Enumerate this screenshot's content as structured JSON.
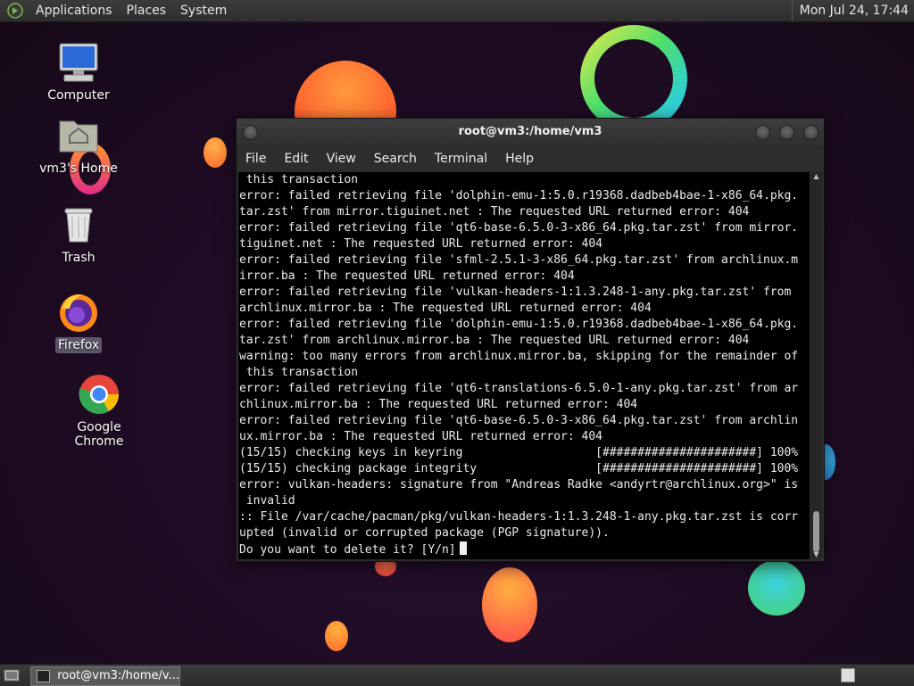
{
  "top_panel": {
    "menus": [
      "Applications",
      "Places",
      "System"
    ],
    "clock": "Mon Jul 24, 17:44"
  },
  "desktop": {
    "icons": [
      {
        "label": "Computer"
      },
      {
        "label": "vm3's Home"
      },
      {
        "label": "Trash"
      },
      {
        "label": "Firefox"
      },
      {
        "label": "Google Chrome"
      }
    ]
  },
  "terminal": {
    "title": "root@vm3:/home/vm3",
    "menu": [
      "File",
      "Edit",
      "View",
      "Search",
      "Terminal",
      "Help"
    ],
    "lines": [
      " this transaction",
      "error: failed retrieving file 'dolphin-emu-1:5.0.r19368.dadbeb4bae-1-x86_64.pkg.",
      "tar.zst' from mirror.tiguinet.net : The requested URL returned error: 404",
      "error: failed retrieving file 'qt6-base-6.5.0-3-x86_64.pkg.tar.zst' from mirror.",
      "tiguinet.net : The requested URL returned error: 404",
      "error: failed retrieving file 'sfml-2.5.1-3-x86_64.pkg.tar.zst' from archlinux.m",
      "irror.ba : The requested URL returned error: 404",
      "error: failed retrieving file 'vulkan-headers-1:1.3.248-1-any.pkg.tar.zst' from",
      "archlinux.mirror.ba : The requested URL returned error: 404",
      "error: failed retrieving file 'dolphin-emu-1:5.0.r19368.dadbeb4bae-1-x86_64.pkg.",
      "tar.zst' from archlinux.mirror.ba : The requested URL returned error: 404",
      "warning: too many errors from archlinux.mirror.ba, skipping for the remainder of",
      " this transaction",
      "error: failed retrieving file 'qt6-translations-6.5.0-1-any.pkg.tar.zst' from ar",
      "chlinux.mirror.ba : The requested URL returned error: 404",
      "error: failed retrieving file 'qt6-base-6.5.0-3-x86_64.pkg.tar.zst' from archlin",
      "ux.mirror.ba : The requested URL returned error: 404",
      "(15/15) checking keys in keyring                   [######################] 100%",
      "(15/15) checking package integrity                 [######################] 100%",
      "error: vulkan-headers: signature from \"Andreas Radke <andyrtr@archlinux.org>\" is",
      " invalid",
      ":: File /var/cache/pacman/pkg/vulkan-headers-1:1.3.248-1-any.pkg.tar.zst is corr",
      "upted (invalid or corrupted package (PGP signature))."
    ],
    "prompt": "Do you want to delete it? [Y/n]"
  },
  "taskbar": {
    "task_label": "root@vm3:/home/v..."
  }
}
